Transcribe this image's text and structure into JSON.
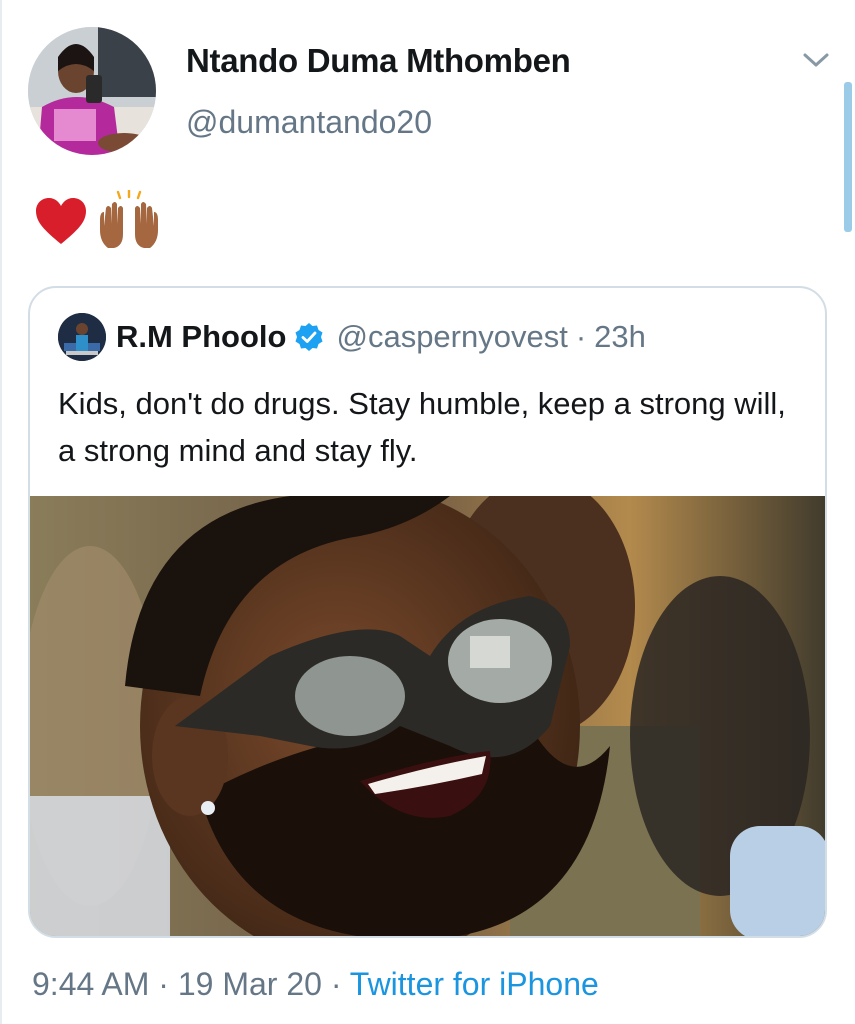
{
  "author": {
    "display_name": "Ntando Duma Mthomben",
    "handle": "@dumantando20"
  },
  "tweet": {
    "emoji": [
      "red-heart",
      "raising-hands-medium-dark-skin"
    ]
  },
  "quoted": {
    "display_name": "R.M Phoolo",
    "verified": true,
    "handle": "@caspernyovest",
    "separator": "·",
    "time": "23h",
    "text": "Kids, don't do drugs. Stay humble, keep a strong will, a strong mind and stay fly."
  },
  "meta": {
    "time": "9:44 AM",
    "sep1": "·",
    "date": "19 Mar 20",
    "sep2": "·",
    "source": "Twitter for iPhone"
  },
  "colors": {
    "text": "#14171a",
    "secondary": "#657786",
    "accent": "#1b95e0",
    "border": "#d3dde5"
  }
}
